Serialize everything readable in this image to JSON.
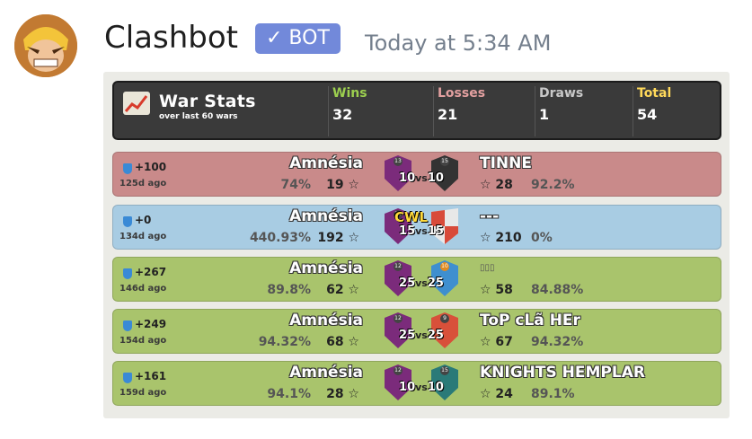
{
  "message": {
    "username": "Clashbot",
    "bot_badge": "✓ BOT",
    "timestamp": "Today at 5:34 AM"
  },
  "colors": {
    "win": "#c98a8a",
    "draw": "#a8cce3",
    "loss": "#a9c46c",
    "wins_label": "#9ccf4f",
    "losses_label": "#e3a0a0",
    "draws_label": "#c8c8c8",
    "total_label": "#ffd95a"
  },
  "header": {
    "title": "War Stats",
    "subtitle": "over last 60 wars",
    "wins_label": "Wins",
    "wins": "32",
    "losses_label": "Losses",
    "losses": "21",
    "draws_label": "Draws",
    "draws": "1",
    "total_label": "Total",
    "total": "54"
  },
  "wars": [
    {
      "result": "win",
      "trophies": "+100",
      "ago": "125d ago",
      "clan": "Amnésia",
      "pct": "74%",
      "stars": "19 ☆",
      "opponent": "TINNE",
      "ostars": "☆ 28",
      "opct": "92.2%",
      "size_own": "10",
      "size_enemy": "10",
      "own_level": "13",
      "enemy_level": "15",
      "cwl": ""
    },
    {
      "result": "draw",
      "trophies": "+0",
      "ago": "134d ago",
      "clan": "Amnésia",
      "pct": "440.93%",
      "stars": "192 ☆",
      "opponent": "---",
      "ostars": "☆ 210",
      "opct": "0%",
      "size_own": "15",
      "size_enemy": "15",
      "own_level": "13",
      "enemy_level": "",
      "cwl": "CWL"
    },
    {
      "result": "loss",
      "trophies": "+267",
      "ago": "146d ago",
      "clan": "Amnésia",
      "pct": "89.8%",
      "stars": "62 ☆",
      "opponent": "▯▯▯",
      "ostars": "☆ 58",
      "opct": "84.88%",
      "size_own": "25",
      "size_enemy": "25",
      "own_level": "12",
      "enemy_level": "10",
      "cwl": ""
    },
    {
      "result": "loss",
      "trophies": "+249",
      "ago": "154d ago",
      "clan": "Amnésia",
      "pct": "94.32%",
      "stars": "68 ☆",
      "opponent": "ToP cLã HEr",
      "ostars": "☆ 67",
      "opct": "94.32%",
      "size_own": "25",
      "size_enemy": "25",
      "own_level": "12",
      "enemy_level": "9",
      "cwl": ""
    },
    {
      "result": "loss",
      "trophies": "+161",
      "ago": "159d ago",
      "clan": "Amnésia",
      "pct": "94.1%",
      "stars": "28 ☆",
      "opponent": "KNIGHTS HEMPLAR",
      "ostars": "☆ 24",
      "opct": "89.1%",
      "size_own": "10",
      "size_enemy": "10",
      "own_level": "12",
      "enemy_level": "15",
      "cwl": ""
    }
  ]
}
